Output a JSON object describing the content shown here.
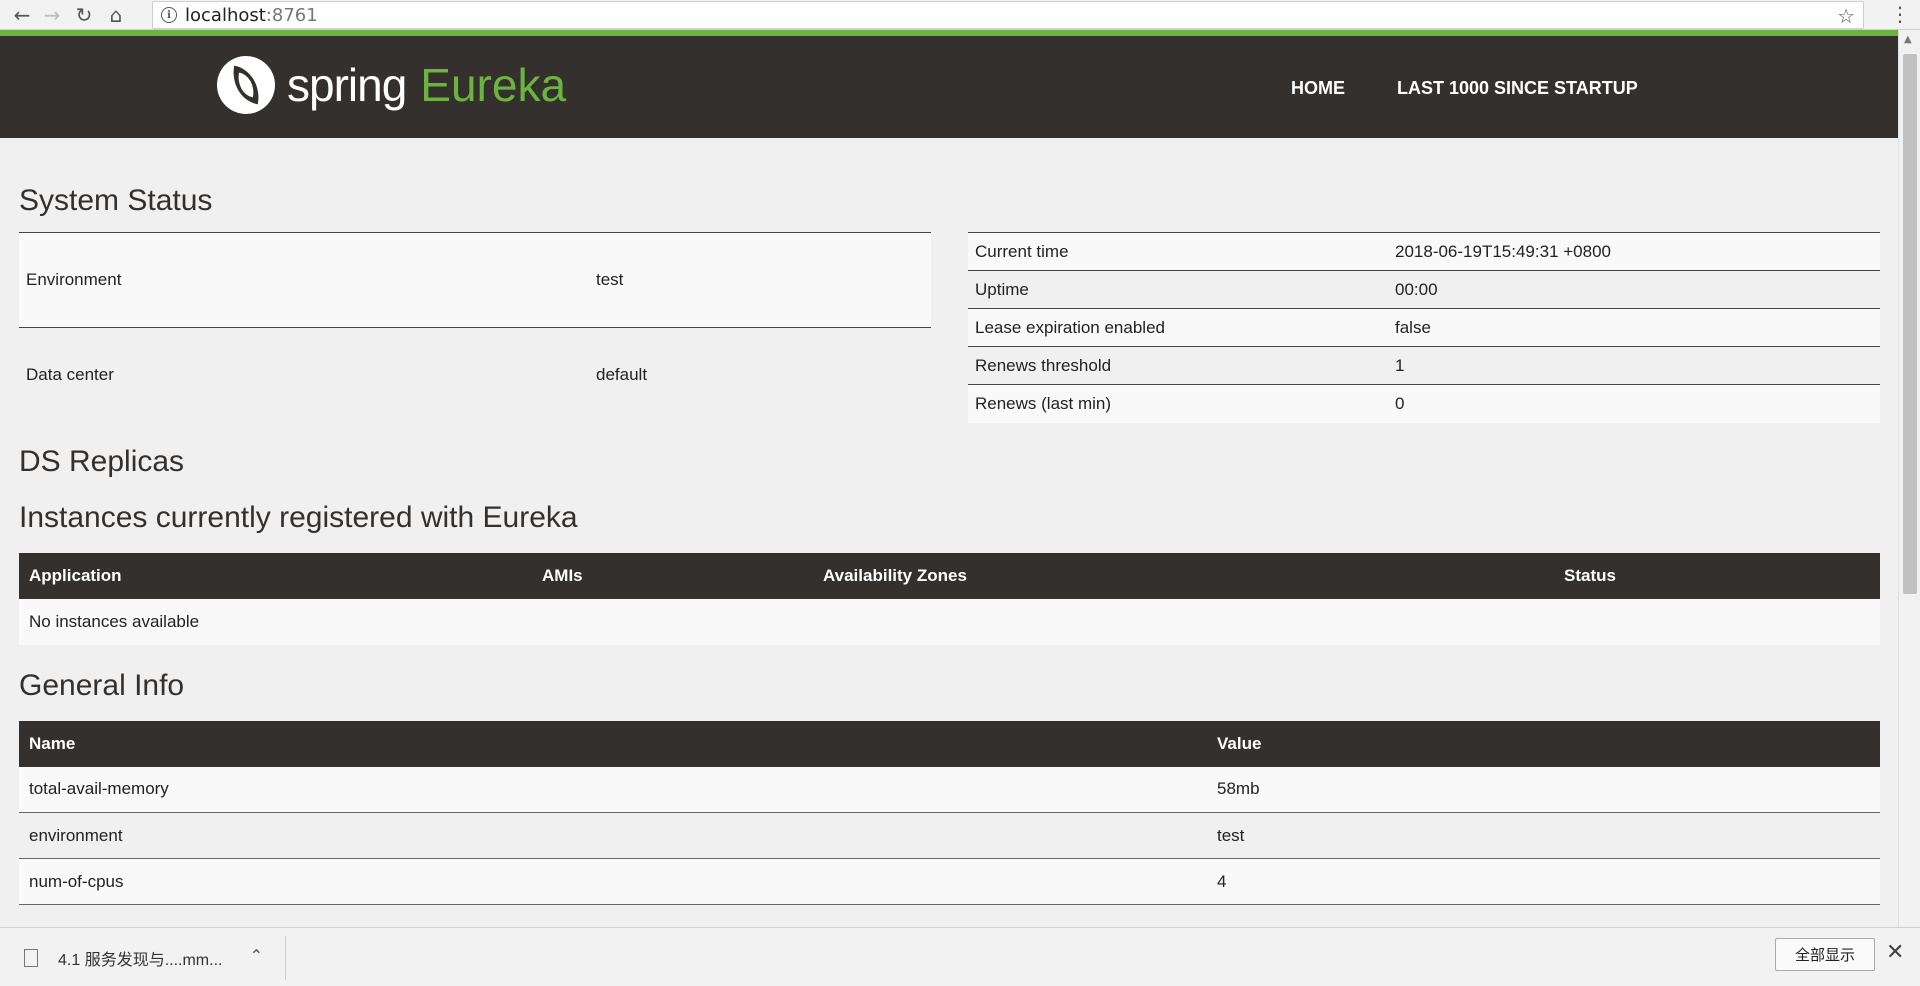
{
  "browser": {
    "url_host": "localhost",
    "url_port": ":8761"
  },
  "header": {
    "logo_spring": "spring",
    "logo_eureka": "Eureka",
    "nav": [
      "HOME",
      "LAST 1000 SINCE STARTUP"
    ]
  },
  "system_status": {
    "title": "System Status",
    "left": [
      {
        "key": "Environment",
        "value": "test"
      },
      {
        "key": "Data center",
        "value": "default"
      }
    ],
    "right": [
      {
        "key": "Current time",
        "value": "2018-06-19T15:49:31 +0800"
      },
      {
        "key": "Uptime",
        "value": "00:00"
      },
      {
        "key": "Lease expiration enabled",
        "value": "false"
      },
      {
        "key": "Renews threshold",
        "value": "1"
      },
      {
        "key": "Renews (last min)",
        "value": "0"
      }
    ]
  },
  "ds_replicas": {
    "title": "DS Replicas"
  },
  "instances": {
    "title": "Instances currently registered with Eureka",
    "columns": [
      "Application",
      "AMIs",
      "Availability Zones",
      "Status"
    ],
    "empty": "No instances available"
  },
  "general_info": {
    "title": "General Info",
    "columns": [
      "Name",
      "Value"
    ],
    "rows": [
      {
        "name": "total-avail-memory",
        "value": "58mb"
      },
      {
        "name": "environment",
        "value": "test"
      },
      {
        "name": "num-of-cpus",
        "value": "4"
      }
    ]
  },
  "download_bar": {
    "file_name": "4.1 服务发现与....mm...",
    "show_all": "全部显示"
  }
}
